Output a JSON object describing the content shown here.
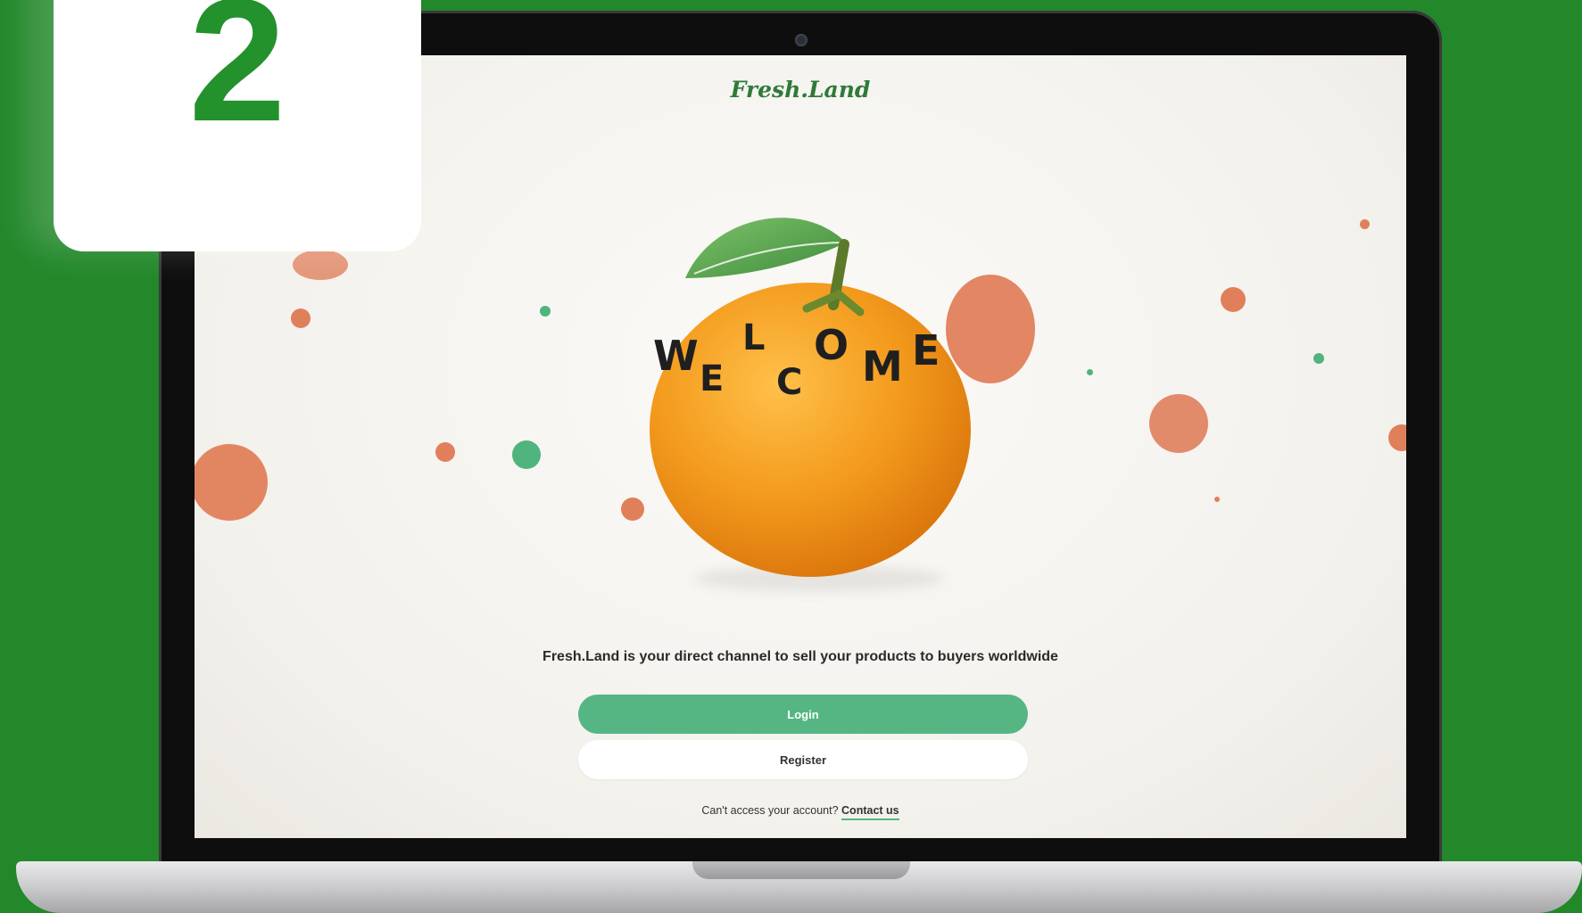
{
  "step": {
    "number": "2"
  },
  "screen": {
    "logo": "Fresh.Land",
    "welcome_letters": [
      "W",
      "E",
      "L",
      "C",
      "O",
      "M",
      "E"
    ],
    "tagline": "Fresh.Land is your direct channel to sell your products to buyers worldwide",
    "login_label": "Login",
    "register_label": "Register",
    "help_text": "Can't access your account?",
    "contact_label": "Contact us"
  },
  "colors": {
    "background_green": "#22882a",
    "step_number": "#23912c",
    "login_button": "#55b684",
    "accent_orange": "#e0805b"
  }
}
